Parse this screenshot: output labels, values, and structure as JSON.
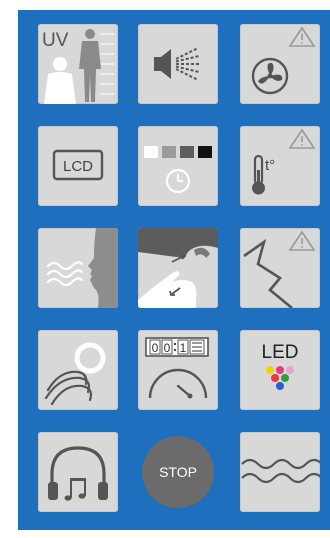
{
  "tiles": {
    "uv": {
      "label": "UV"
    },
    "lcd": {
      "label": "LCD"
    },
    "temp": {
      "label": "t°"
    },
    "led": {
      "label": "LED"
    },
    "timer": {
      "digits": [
        "0",
        "0",
        "1"
      ]
    },
    "stop": {
      "label": "STOP"
    }
  },
  "colors": {
    "panel": "#1e6fbe",
    "tile": "#d8d8d8",
    "icon": "#6e6e6e",
    "stop_disc": "#6b6b6b"
  },
  "icons": [
    "uv-body-icon",
    "speaker-icon",
    "fan-icon",
    "lcd-icon",
    "contrast-timer-icon",
    "thermometer-icon",
    "face-airflow-icon",
    "hand-water-icon",
    "crack-icon",
    "wind-spiral-icon",
    "counter-gauge-icon",
    "led-cluster-icon",
    "headphones-music-icon",
    "stop-icon",
    "wave-icon"
  ]
}
